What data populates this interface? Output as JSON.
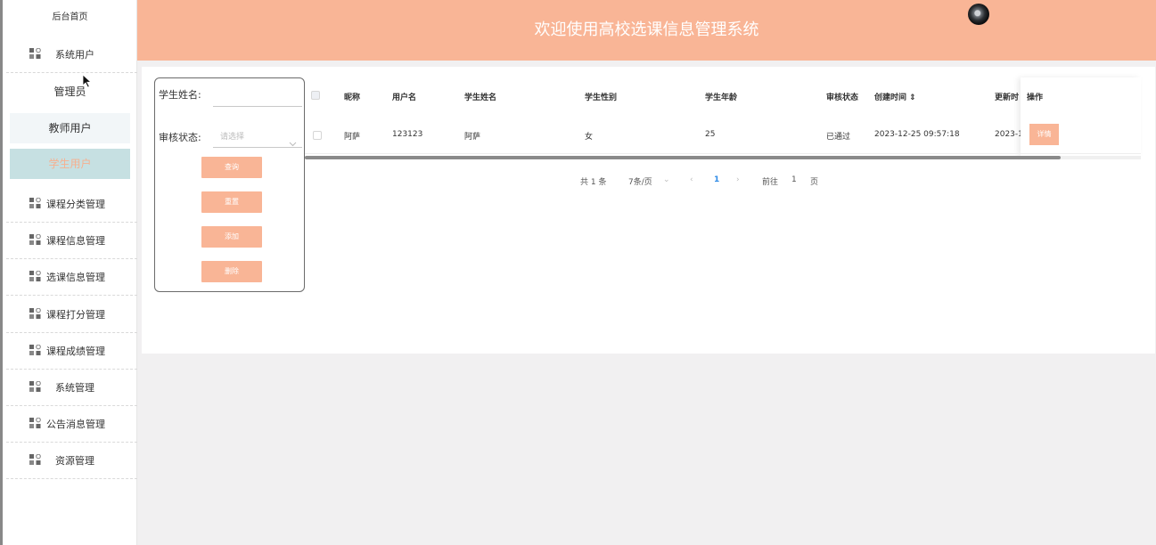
{
  "sidebar": {
    "home": "后台首页",
    "system_users": "系统用户",
    "sub": {
      "admin": "管理员",
      "teacher": "教师用户",
      "student": "学生用户"
    },
    "items": [
      {
        "label": "课程分类管理"
      },
      {
        "label": "课程信息管理"
      },
      {
        "label": "选课信息管理"
      },
      {
        "label": "课程打分管理"
      },
      {
        "label": "课程成绩管理"
      },
      {
        "label": "系统管理"
      },
      {
        "label": "公告消息管理"
      },
      {
        "label": "资源管理"
      }
    ]
  },
  "header": {
    "title": "欢迎使用高校选课信息管理系统"
  },
  "search": {
    "name_label": "学生姓名:",
    "name_value": "",
    "status_label": "审核状态:",
    "status_placeholder": "请选择",
    "buttons": {
      "query": "查询",
      "reset": "重置",
      "add": "添加",
      "delete": "删除"
    }
  },
  "table": {
    "columns": [
      "昵称",
      "用户名",
      "学生姓名",
      "学生性别",
      "学生年龄",
      "审核状态",
      "创建时间 ⇕",
      "更新时",
      "操作"
    ],
    "rows": [
      {
        "nickname": "阿萨",
        "username": "123123",
        "student_name": "阿萨",
        "gender": "女",
        "age": "25",
        "status": "已通过",
        "created": "2023-12-25 09:57:18",
        "updated": "2023-1",
        "action": "详情"
      }
    ]
  },
  "pagination": {
    "total": "共 1 条",
    "page_size": "7条/页",
    "current": "1",
    "goto_label": "前往",
    "goto_value": "1",
    "page_suffix": "页"
  },
  "colors": {
    "accent": "#f9b596",
    "active_sub_bg": "#c6e0e2",
    "page_active": "#2f8be6"
  }
}
